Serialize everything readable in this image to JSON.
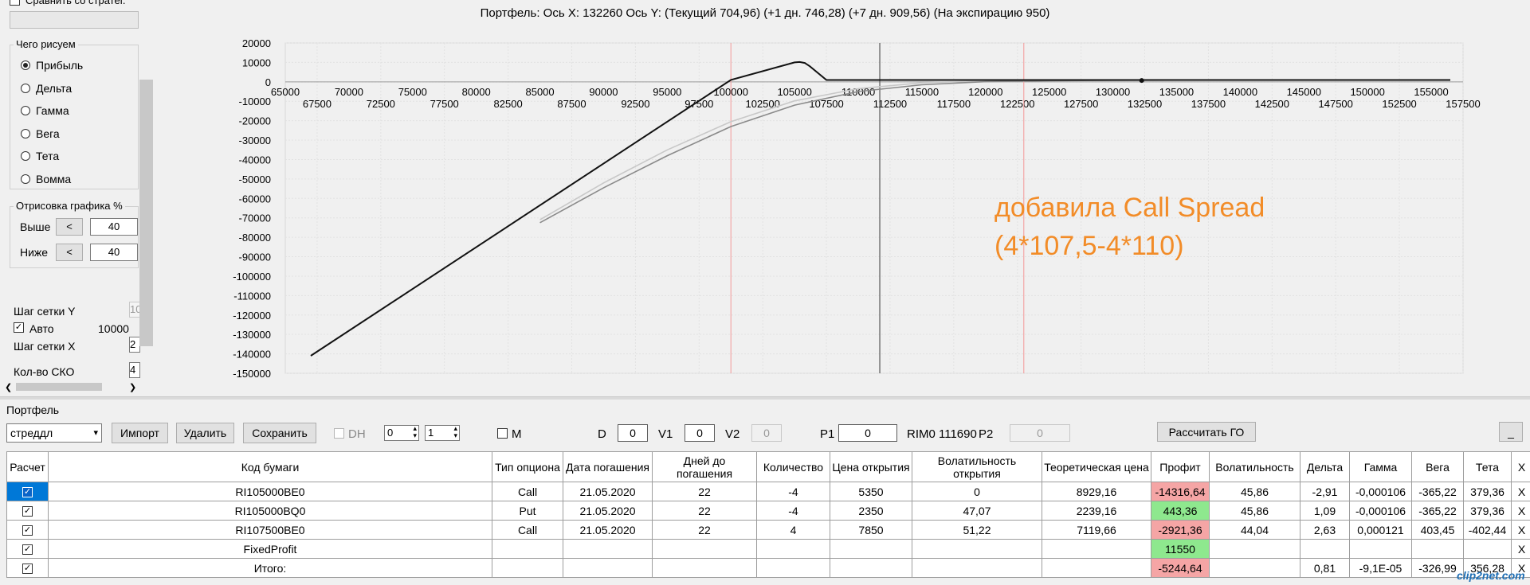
{
  "left_panel": {
    "top_checkbox_label": "Сравнить со стратег.",
    "what_to_draw": {
      "title": "Чего рисуем",
      "options": [
        "Прибыль",
        "Дельта",
        "Гамма",
        "Вега",
        "Тета",
        "Вомма"
      ],
      "selected": "Прибыль"
    },
    "drawing_percent": {
      "title": "Отрисовка графика %",
      "above_label": "Выше",
      "above_button": "<",
      "above_value": "40",
      "below_label": "Ниже",
      "below_button": "<",
      "below_value": "40"
    },
    "grid_step_y_label": "Шаг сетки Y",
    "grid_step_y_value": "10",
    "auto_label": "Авто",
    "auto_checked": true,
    "auto_value": "10000",
    "grid_step_x_label": "Шаг сетки X",
    "grid_step_x_value": "2",
    "sko_count_label": "Кол-во СКО",
    "sko_count_value": "4"
  },
  "chart": {
    "title": "Портфель: Ось X: 132260 Ось Y:  (Текущий 704,96)  (+1 дн. 746,28)  (+7 дн. 909,56)  (На экспирацию 950)",
    "annotation_line1": "добавила Call Spread",
    "annotation_line2": "(4*107,5-4*110)",
    "annotation_color": "#f28c28"
  },
  "chart_data": {
    "type": "line",
    "x_ticks_upper": [
      65000,
      70000,
      75000,
      80000,
      85000,
      90000,
      95000,
      100000,
      105000,
      110000,
      115000,
      120000,
      125000,
      130000,
      135000,
      140000,
      145000,
      150000,
      155000
    ],
    "x_ticks_lower": [
      67500,
      72500,
      77500,
      82500,
      87500,
      92500,
      97500,
      102500,
      107500,
      112500,
      117500,
      122500,
      127500,
      132500,
      137500,
      142500,
      147500,
      152500,
      157500
    ],
    "y_ticks": [
      20000,
      10000,
      0,
      -10000,
      -20000,
      -30000,
      -40000,
      -50000,
      -60000,
      -70000,
      -80000,
      -90000,
      -100000,
      -110000,
      -120000,
      -130000,
      -140000,
      -150000
    ],
    "xlim": [
      65000,
      157500
    ],
    "ylim": [
      -150000,
      20000
    ],
    "grid": true,
    "vertical_markers": [
      {
        "x": 100000,
        "color": "#f3a6a6"
      },
      {
        "x": 111690,
        "color": "#555555"
      },
      {
        "x": 123000,
        "color": "#f3a6a6"
      }
    ],
    "current_point": {
      "x": 132260,
      "y": 705
    },
    "series": [
      {
        "color": "#111111",
        "x": [
          67000,
          100000,
          105000,
          105400,
          105800,
          106200,
          107500,
          110000,
          120000,
          130000,
          140000,
          150000,
          156500
        ],
        "y": [
          -141000,
          1000,
          10000,
          10200,
          9700,
          8000,
          950,
          950,
          950,
          950,
          950,
          950,
          950
        ]
      },
      {
        "color": "#c8c8c8",
        "x": [
          85000,
          90000,
          95000,
          100000,
          105000,
          110000,
          115000,
          120000,
          125000,
          130000,
          135000,
          140000,
          145000,
          150000,
          156500
        ],
        "y": [
          -71000,
          -52000,
          -35000,
          -20500,
          -9800,
          -3500,
          -500,
          500,
          800,
          900,
          920,
          930,
          940,
          945,
          950
        ]
      },
      {
        "color": "#8a8a8a",
        "x": [
          85000,
          90000,
          95000,
          100000,
          105000,
          110000,
          115000,
          120000,
          125000,
          130000,
          135000,
          140000,
          145000,
          150000,
          156500
        ],
        "y": [
          -72500,
          -54500,
          -38000,
          -23000,
          -12000,
          -5000,
          -1500,
          100,
          600,
          800,
          870,
          900,
          910,
          915,
          920
        ]
      }
    ]
  },
  "portfolio": {
    "label": "Портфель",
    "selected_portfolio": "стреддл",
    "import_btn": "Импорт",
    "delete_btn": "Удалить",
    "save_btn": "Сохранить",
    "dh_label": "DH",
    "spin1": "0",
    "spin2": "1",
    "m_label": "M",
    "d_label": "D",
    "d_value": "0",
    "v1_label": "V1",
    "v1_value": "0",
    "v2_label": "V2",
    "v2_value": "0",
    "p1_label": "P1",
    "p1_value": "0",
    "rim_label": "RIM0 111690",
    "p2_label": "P2",
    "p2_value": "0",
    "calc_go_btn": "Рассчитать ГО",
    "minimize_btn": "_"
  },
  "table": {
    "columns": [
      "Расчет",
      "Код бумаги",
      "Тип опциона",
      "Дата погашения",
      "Дней до погашения",
      "Количество",
      "Цена открытия",
      "Волатильность открытия",
      "Теоретическая цена",
      "Профит",
      "Волатильность",
      "Дельта",
      "Гамма",
      "Вега",
      "Тета",
      "X"
    ],
    "rows": [
      {
        "calc": "☑",
        "code": "RI105000BE0",
        "type": "Call",
        "date": "21.05.2020",
        "days": "22",
        "qty": "-4",
        "open_price": "5350",
        "open_vol": "0",
        "theor": "8929,16",
        "profit": "-14316,64",
        "profit_color": "#f5a5a5",
        "vol": "45,86",
        "delta": "-2,91",
        "gamma": "-0,000106",
        "vega": "-365,22",
        "theta": "379,36",
        "x": "X"
      },
      {
        "calc": "☑",
        "code": "RI105000BQ0",
        "type": "Put",
        "date": "21.05.2020",
        "days": "22",
        "qty": "-4",
        "open_price": "2350",
        "open_vol": "47,07",
        "theor": "2239,16",
        "profit": "443,36",
        "profit_color": "#8ee88e",
        "vol": "45,86",
        "delta": "1,09",
        "gamma": "-0,000106",
        "vega": "-365,22",
        "theta": "379,36",
        "x": "X"
      },
      {
        "calc": "☑",
        "code": "RI107500BE0",
        "type": "Call",
        "date": "21.05.2020",
        "days": "22",
        "qty": "4",
        "open_price": "7850",
        "open_vol": "51,22",
        "theor": "7119,66",
        "profit": "-2921,36",
        "profit_color": "#f5a5a5",
        "vol": "44,04",
        "delta": "2,63",
        "gamma": "0,000121",
        "vega": "403,45",
        "theta": "-402,44",
        "x": "X"
      },
      {
        "calc": "☑",
        "code": "FixedProfit",
        "type": "",
        "date": "",
        "days": "",
        "qty": "",
        "open_price": "",
        "open_vol": "",
        "theor": "",
        "profit": "11550",
        "profit_color": "#8ee88e",
        "vol": "",
        "delta": "",
        "gamma": "",
        "vega": "",
        "theta": "",
        "x": "X"
      },
      {
        "calc": "☑",
        "code": "Итого:",
        "type": "",
        "date": "",
        "days": "",
        "qty": "",
        "open_price": "",
        "open_vol": "",
        "theor": "",
        "profit": "-5244,64",
        "profit_color": "#f5a5a5",
        "vol": "",
        "delta": "0,81",
        "gamma": "-9,1E-05",
        "vega": "-326,99",
        "theta": "356,28",
        "x": "X"
      }
    ]
  },
  "watermark": "clip2net.com"
}
